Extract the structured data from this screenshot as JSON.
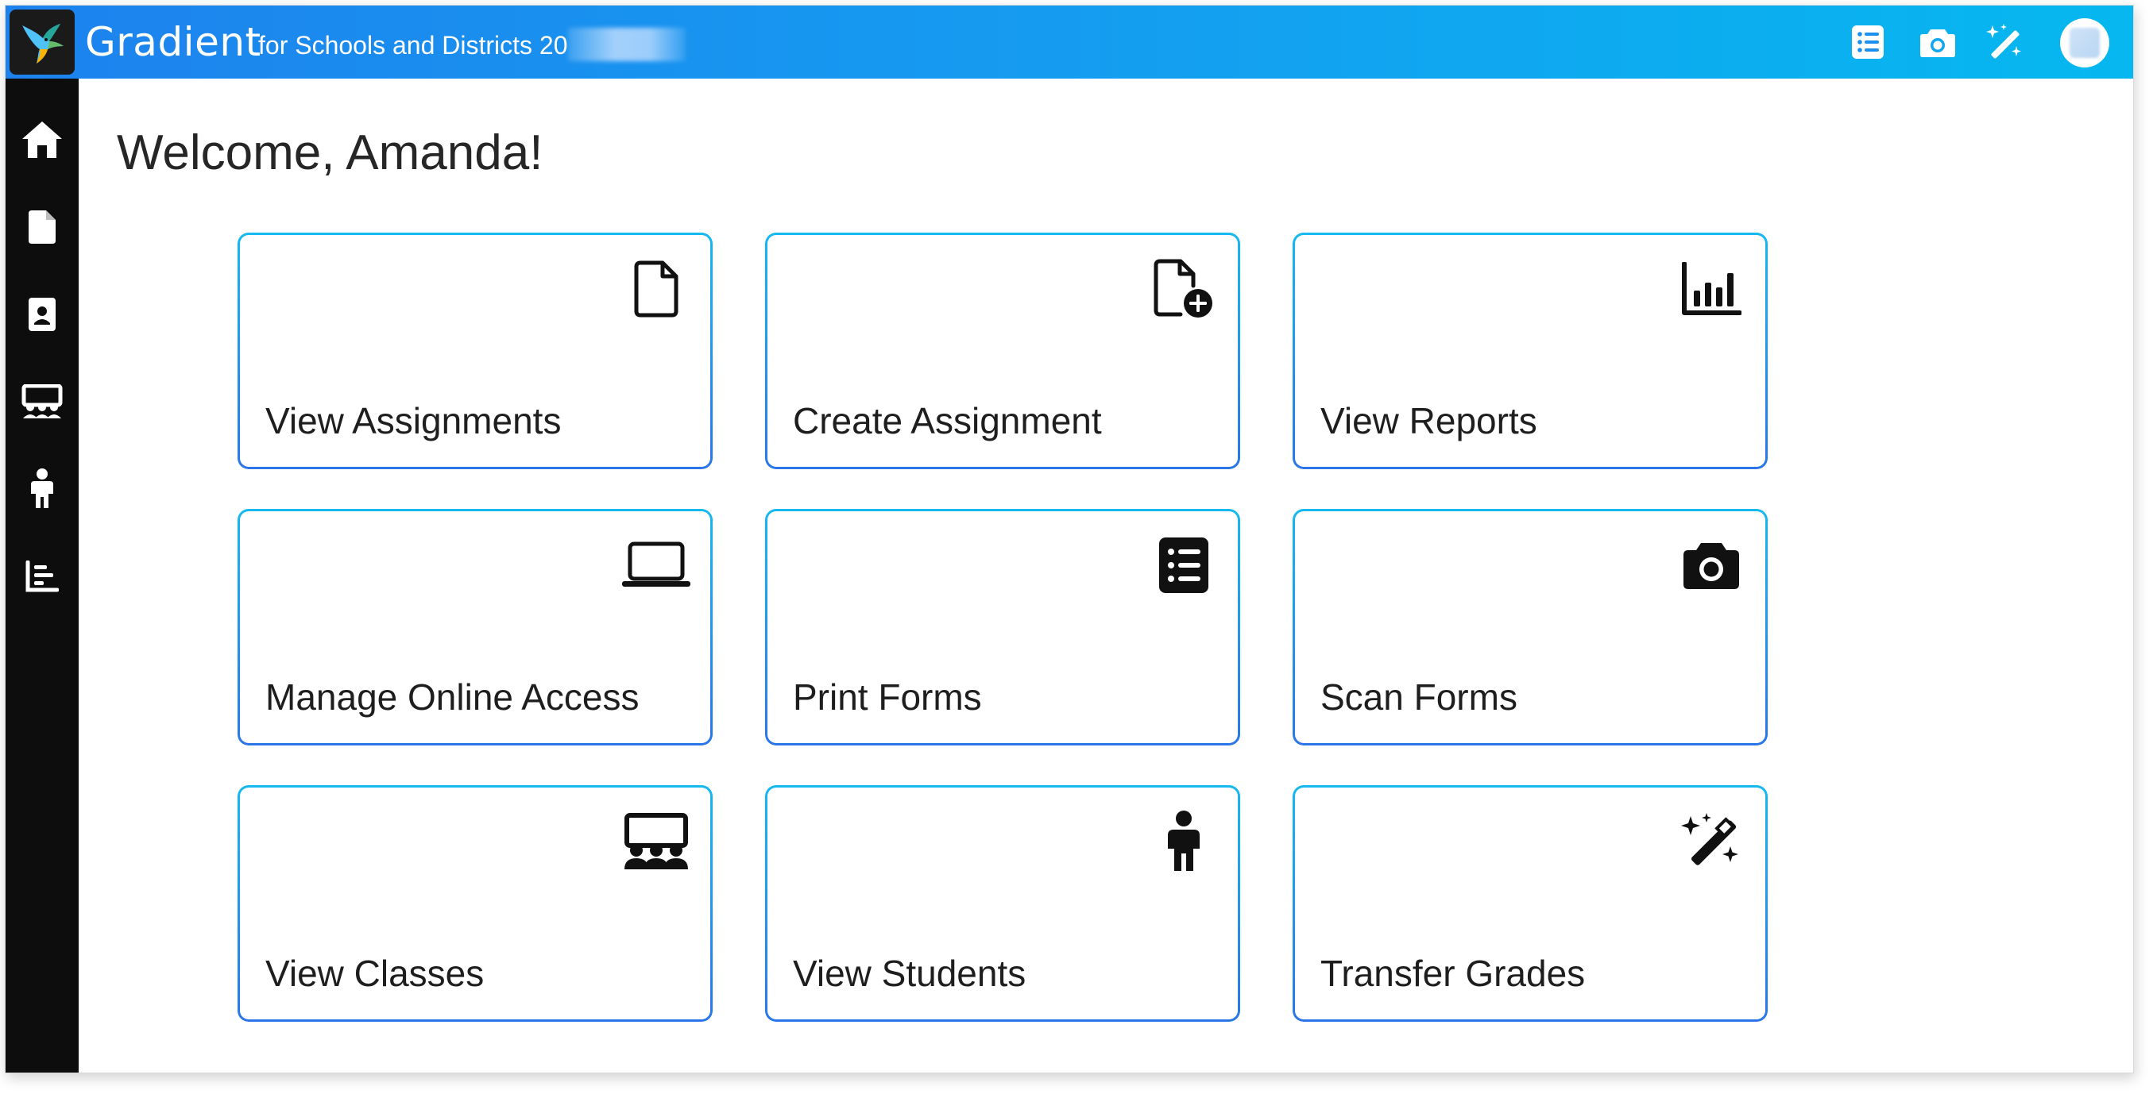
{
  "header": {
    "brand": "Gradient",
    "org_name": "for Schools and Districts 20",
    "actions": [
      {
        "name": "list-icon"
      },
      {
        "name": "camera-icon"
      },
      {
        "name": "magic-wand-icon"
      }
    ]
  },
  "sidebar": {
    "items": [
      {
        "name": "home-icon"
      },
      {
        "name": "document-icon"
      },
      {
        "name": "contact-card-icon"
      },
      {
        "name": "classroom-icon"
      },
      {
        "name": "student-icon"
      },
      {
        "name": "reports-chart-icon"
      }
    ]
  },
  "main": {
    "welcome": "Welcome, Amanda!",
    "cards": [
      {
        "label": "View Assignments",
        "icon": "document-icon"
      },
      {
        "label": "Create Assignment",
        "icon": "document-add-icon"
      },
      {
        "label": "View Reports",
        "icon": "bar-chart-icon"
      },
      {
        "label": "Manage Online Access",
        "icon": "laptop-icon"
      },
      {
        "label": "Print Forms",
        "icon": "list-icon"
      },
      {
        "label": "Scan Forms",
        "icon": "camera-icon"
      },
      {
        "label": "View Classes",
        "icon": "classroom-icon"
      },
      {
        "label": "View Students",
        "icon": "student-icon"
      },
      {
        "label": "Transfer Grades",
        "icon": "magic-wand-icon"
      }
    ]
  },
  "colors": {
    "header_start": "#1d82ee",
    "header_end": "#06b8ef",
    "sidebar": "#0d0d0d",
    "card_border_top": "#16b9f0",
    "card_border_bottom": "#2a76e8"
  }
}
